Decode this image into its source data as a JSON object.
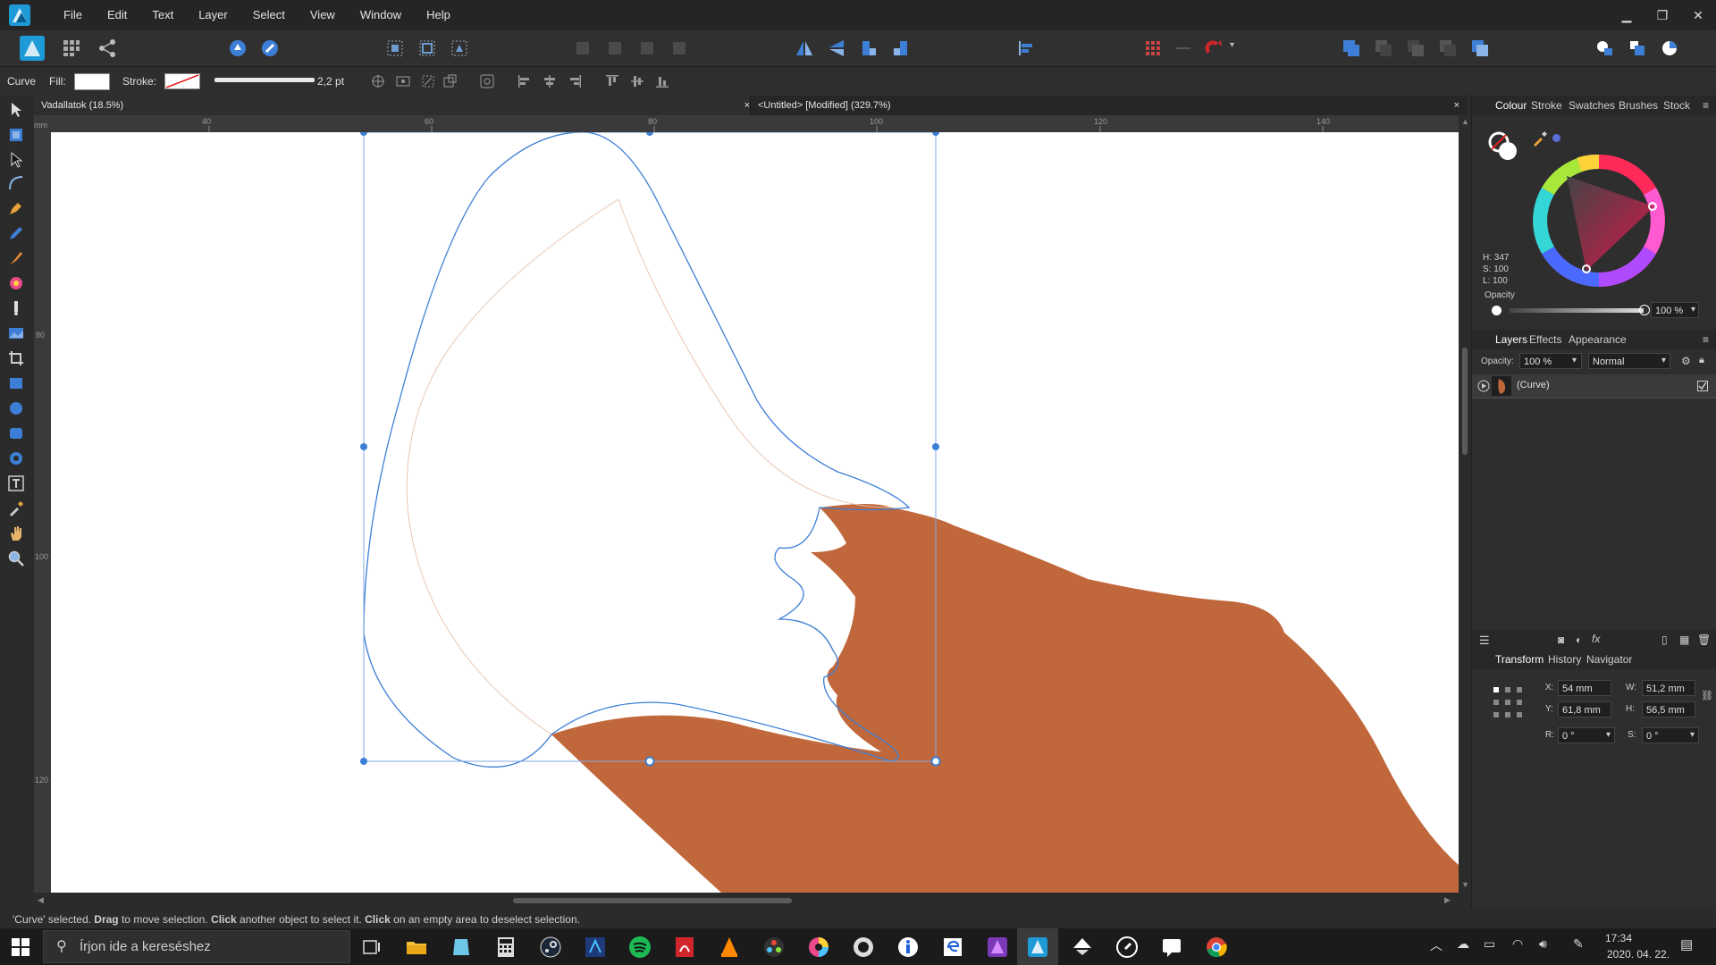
{
  "menubar": {
    "items": [
      "File",
      "Edit",
      "Text",
      "Layer",
      "Select",
      "View",
      "Window",
      "Help"
    ]
  },
  "contextbar": {
    "object_type": "Curve",
    "fill_label": "Fill:",
    "stroke_label": "Stroke:",
    "stroke_width": "2,2 pt"
  },
  "tabs": [
    {
      "label": "Vadallatok (18.5%)",
      "close": "×"
    },
    {
      "label": "<Untitled> [Modified] (329.7%)",
      "close": "×"
    }
  ],
  "ruler": {
    "top_ticks": [
      "40",
      "60",
      "80",
      "100",
      "120",
      "140"
    ],
    "left_ticks": [
      "80",
      "100",
      "120"
    ],
    "unit": "mm"
  },
  "status": {
    "parts": [
      {
        "t": "'Curve' selected. ",
        "b": false
      },
      {
        "t": "Drag",
        "b": true
      },
      {
        "t": " to move selection. ",
        "b": false
      },
      {
        "t": "Click",
        "b": true
      },
      {
        "t": " another object to select it. ",
        "b": false
      },
      {
        "t": "Click",
        "b": true
      },
      {
        "t": " on an empty area to deselect selection.",
        "b": false
      }
    ]
  },
  "colour_panel": {
    "tabs": [
      "Colour",
      "Stroke",
      "Swatches",
      "Brushes",
      "Stock"
    ],
    "h": "H: 347",
    "s": "S: 100",
    "l": "L: 100",
    "opacity_label": "Opacity",
    "opacity_value": "100 %"
  },
  "layers_panel": {
    "tabs": [
      "Layers",
      "Effects",
      "Appearance"
    ],
    "opacity_label": "Opacity:",
    "opacity_value": "100 %",
    "blend_mode": "Normal",
    "layer_name": "(Curve)"
  },
  "transform_panel": {
    "tabs": [
      "Transform",
      "History",
      "Navigator"
    ],
    "x_label": "X:",
    "x": "54 mm",
    "y_label": "Y:",
    "y": "61,8 mm",
    "w_label": "W:",
    "w": "51,2 mm",
    "h_label": "H:",
    "h": "56,5 mm",
    "r_label": "R:",
    "r": "0 °",
    "s_label": "S:",
    "s": "0 °"
  },
  "taskbar": {
    "search_placeholder": "Írjon ide a kereséshez",
    "time": "17:34",
    "date": "2020. 04. 22."
  },
  "colors": {
    "fill_brown": "#c0673b",
    "selection_blue": "#3d7fd6",
    "accent": "#1e9bd7"
  }
}
